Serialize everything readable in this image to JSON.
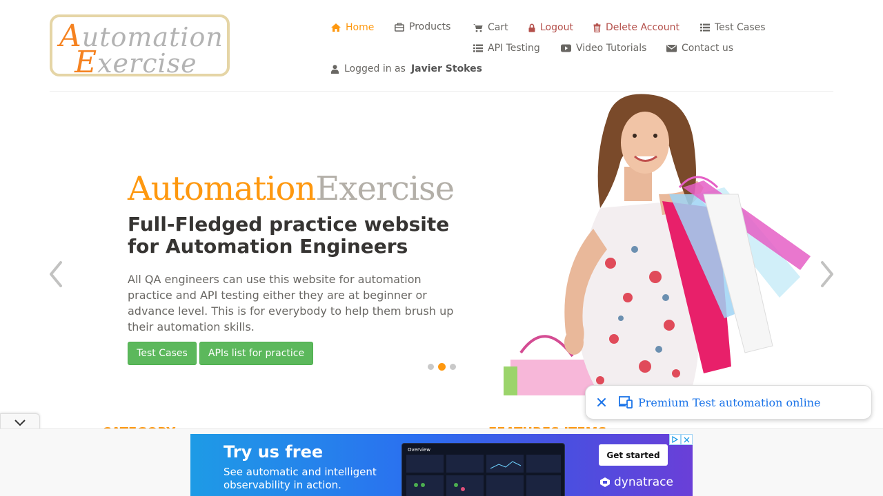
{
  "logo": {
    "line1_cap": "A",
    "line1_rest": "utomation",
    "line2_cap": "E",
    "line2_rest": "xercise"
  },
  "nav": {
    "home": "Home",
    "products": "Products",
    "cart": "Cart",
    "logout": "Logout",
    "delete_account": "Delete Account",
    "test_cases": "Test Cases",
    "api_testing": "API Testing",
    "video_tutorials": "Video Tutorials",
    "contact_us": "Contact us",
    "logged_in_prefix": "Logged in as",
    "logged_in_user": "Javier Stokes"
  },
  "slider": {
    "title_part1": "Automation",
    "title_part2": "Exercise",
    "heading": "Full-Fledged practice website for Automation Engineers",
    "description": "All QA engineers can use this website for automation practice and API testing either they are at beginner or advance level. This is for everybody to help them brush up their automation skills.",
    "button_test_cases": "Test Cases",
    "button_apis": "APIs list for practice",
    "active_slide": 2,
    "slide_count": 3
  },
  "sections": {
    "category": "CATEGORY",
    "features": "FEATURES ITEMS"
  },
  "promo_chip": {
    "text": "Premium Test automation online"
  },
  "ad": {
    "headline": "Try us free",
    "sub1": "See automatic and intelligent",
    "sub2": "observability in action.",
    "cta": "Get started",
    "brand": "dynatrace",
    "screenshot_title": "Overview"
  },
  "colors": {
    "accent": "#fe980f",
    "button_green": "#5cb85c",
    "danger": "#b4504b",
    "link_blue": "#1a73e8"
  }
}
